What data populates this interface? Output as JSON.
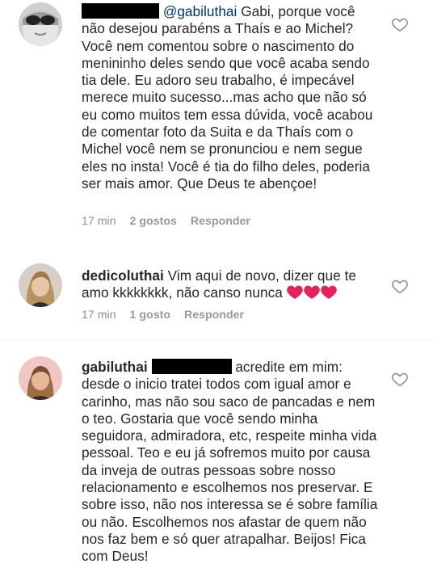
{
  "comments": [
    {
      "username": "",
      "mention": "@gabiluthai",
      "text": " Gabi, porque você não desejou parabéns a Thaís e ao Michel? Você nem comentou sobre o nascimento do menininho deles sendo que você acaba sendo tia dele. Eu adoro seu trabalho, é impecável merece muito sucesso...mas acho que não só eu como muitos tem essa dúvida, você acabou de comentar foto da Suita e da Thaís com o Michel você nem se pronunciou e nem segue eles no insta! Você é tia do filho deles, poderia ser mais amor. Que Deus te abençoe!",
      "time": "17 min",
      "likes": "2 gostos",
      "reply": "Responder",
      "avatar_icon": "avatar-sunglasses"
    },
    {
      "username": "dedicoluthai",
      "text": "Vim aqui de novo, dizer que te amo kkkkkkkk, não canso nunca",
      "emoji": "three-pink-hearts",
      "time": "17 min",
      "likes": "1 gosto",
      "reply": "Responder",
      "avatar_icon": "avatar-blonde-woman"
    },
    {
      "username": "gabiluthai",
      "text": " acredite em mim: desde o inicio tratei todos com igual amor e carinho, mas não sou saco de pancadas e nem o teo. Gostaria que você sendo minha seguidora, admiradora, etc, respeite minha vida pessoal. Teo e eu já sofremos muito por causa da inveja de outras pessoas sobre nosso relacionamento e escolhemos nos preservar. E sobre isso, não nos interessa se é sobre família ou não. Escolhemos nos afastar de quem não nos faz bem e só quer atrapalhar. Beijos! Fica com Deus!",
      "avatar_icon": "avatar-woman-pink-bg"
    }
  ],
  "colors": {
    "text": "#262626",
    "meta": "#8e8e8e",
    "mention": "#003569",
    "heart_emoji": "#e0245e"
  },
  "icons": {
    "like": "heart-outline-icon"
  }
}
